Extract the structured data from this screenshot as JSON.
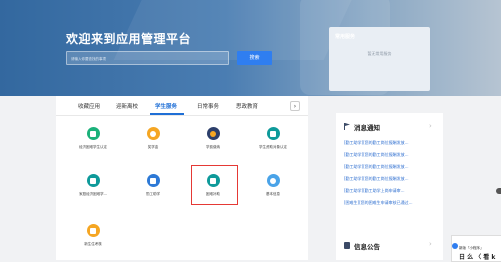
{
  "banner": {
    "welcome": "欢迎来到应用管理平台",
    "search_placeholder": "请输入你要查找的事项",
    "search_button": "搜索"
  },
  "common_services": {
    "title": "常用服务",
    "empty_text": "暂无常用服务"
  },
  "tabs": {
    "items": [
      "收藏应用",
      "迎新离校",
      "学生服务",
      "日常事务",
      "思政教育"
    ],
    "active": "学生服务",
    "more": "›"
  },
  "services": [
    {
      "label": "经济困难学生认定",
      "color": "#1bb17a"
    },
    {
      "label": "奖学金",
      "color": "#f5a623"
    },
    {
      "label": "学费缴纳",
      "color": "#2c3f6b"
    },
    {
      "label": "学生资助对象认定",
      "color": "#0e9a9a"
    },
    {
      "label": "家庭经济困难学...",
      "color": "#0e9a9a"
    },
    {
      "label": "勤工助学",
      "color": "#2d79d6"
    },
    {
      "label": "困难补助",
      "color": "#0e9a9a"
    },
    {
      "label": "基本信息",
      "color": "#4aa3e8"
    },
    {
      "label": "新生住考核",
      "color": "#f5a623"
    }
  ],
  "news": {
    "title": "消息通知",
    "more": "›",
    "items": [
      "[勤工助学][您的勤工岗位报酬发放...",
      "[勤工助学][您的勤工岗位报酬发放...",
      "[勤工助学][您的勤工岗位报酬发放...",
      "[勤工助学][您的勤工岗位报酬发放...",
      "[勤工助学][勤工助学上岗申请审...",
      "[困难生][您的困难生申请审核已通过..."
    ]
  },
  "info": {
    "title": "信息公告",
    "more": "›"
  },
  "float_widget": {
    "line1": "新版「小程序」",
    "line2": "日 么 〈 看 k"
  }
}
